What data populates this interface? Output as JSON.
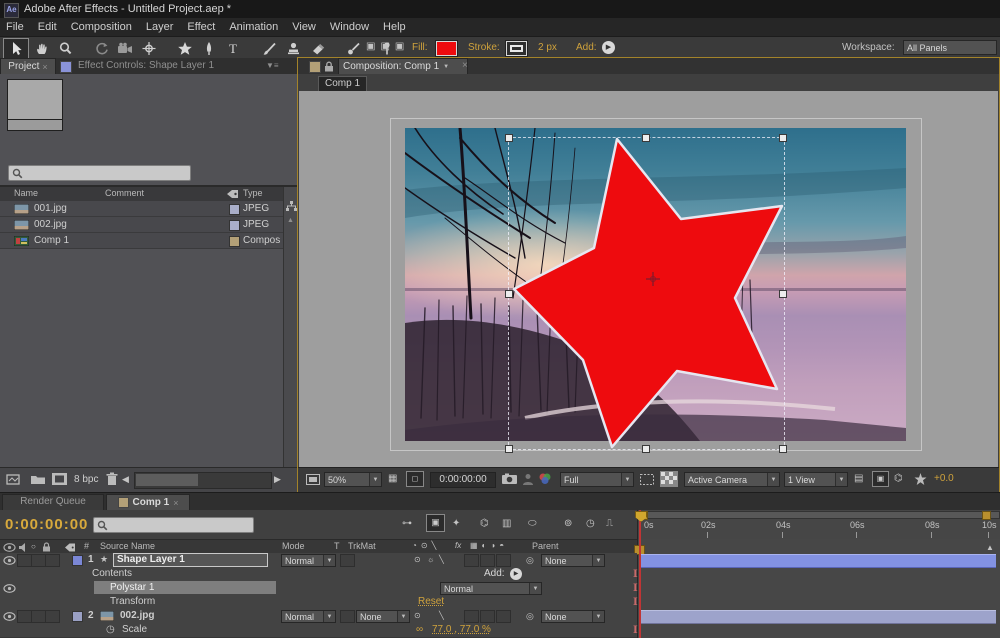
{
  "window": {
    "logo": "Ae",
    "title": "Adobe After Effects - Untitled Project.aep *"
  },
  "menu": {
    "items": [
      "File",
      "Edit",
      "Composition",
      "Layer",
      "Effect",
      "Animation",
      "View",
      "Window",
      "Help"
    ]
  },
  "toolbar": {
    "fill_label": "Fill:",
    "fill_color": "#ee0b0e",
    "stroke_label": "Stroke:",
    "stroke_width": "2 px",
    "add_label": "Add:",
    "workspace_label": "Workspace:",
    "workspace_value": "All Panels"
  },
  "project": {
    "tab_project": "Project",
    "tab_effect_controls": "Effect Controls: Shape Layer 1",
    "columns": {
      "name": "Name",
      "comment": "Comment",
      "type": "Type"
    },
    "items": [
      {
        "name": "001.jpg",
        "type": "JPEG",
        "swatch": "#a9aec9"
      },
      {
        "name": "002.jpg",
        "type": "JPEG",
        "swatch": "#a9aec9"
      },
      {
        "name": "Comp 1",
        "type": "Compos",
        "swatch": "#b3a077"
      }
    ],
    "bpc": "8 bpc"
  },
  "comp": {
    "tab_label": "Composition: Comp 1",
    "comp_chip": "Comp 1",
    "zoom": "50%",
    "timecode": "0:00:00:00",
    "resolution": "Full",
    "camera": "Active Camera",
    "view": "1 View",
    "exposure": "+0.0",
    "star_fill": "#ee0b0e"
  },
  "timeline": {
    "tab_render_queue": "Render Queue",
    "tab_comp": "Comp 1",
    "timecode": "0:00:00:00",
    "ruler_labels": [
      "0s",
      "02s",
      "04s",
      "06s",
      "08s",
      "10s"
    ],
    "columns": {
      "source_name": "Source Name",
      "mode": "Mode",
      "t": "T",
      "trkmat": "TrkMat",
      "parent": "Parent"
    },
    "rows": {
      "layer1": {
        "num": "1",
        "name": "Shape Layer 1",
        "mode": "Normal",
        "parent": "None"
      },
      "contents": {
        "label": "Contents",
        "add_label": "Add:"
      },
      "polystar": {
        "label": "Polystar 1",
        "mode": "Normal"
      },
      "transform": {
        "label": "Transform",
        "reset": "Reset"
      },
      "layer2": {
        "num": "2",
        "name": "002.jpg",
        "mode": "Normal",
        "trkmat": "None",
        "parent": "None"
      },
      "scale": {
        "label": "Scale",
        "link": "∞",
        "value": "77.0 , 77.0 %"
      }
    }
  },
  "icons": {
    "chevron_down": "▼",
    "chevron_right": "▶",
    "chevron_left": "◀",
    "chevron_up": "▲",
    "close": "×",
    "play_circle": "▶",
    "solo": "○",
    "pick_whip": "◎",
    "stopwatch": "◷",
    "collapse": "⊙",
    "quality": "╲",
    "sun": "☼",
    "fx": "fx",
    "frame_blend": "▦",
    "motion_blur": "◐",
    "adjustment": "◑",
    "threed": "◓",
    "shy": "◔",
    "hash": "#",
    "panel_menu": "▼≡",
    "grid": "▦",
    "flow": "⌬",
    "star": "★"
  }
}
